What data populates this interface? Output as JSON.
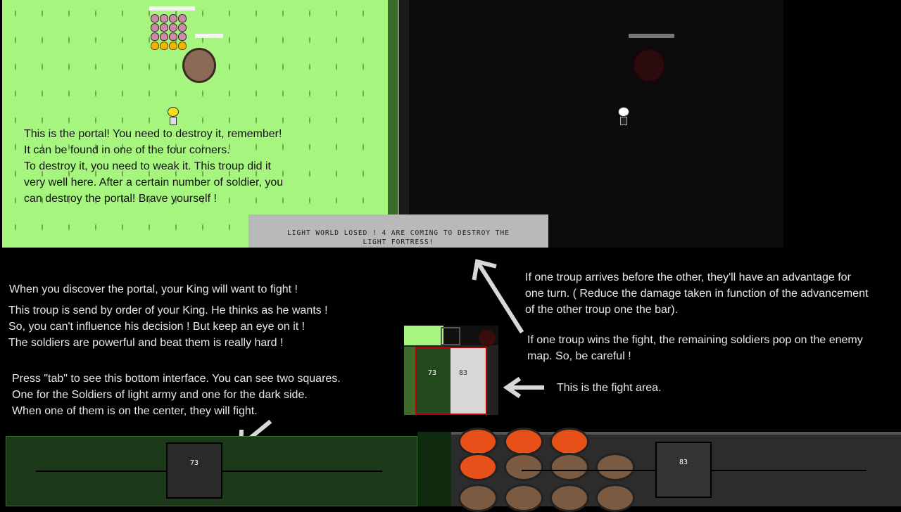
{
  "light_world": {
    "tutorial_lines": [
      "This is the portal! You need to destroy it, remember!",
      "It can be found in one of the four corners.",
      "To destroy it, you need to weak it. This troup did it",
      "very well here. After a certain number of soldier, you",
      "can destroy the portal! Brave yourself !"
    ]
  },
  "message_banner": {
    "line1": "Light world losed ! 4 are coming to destroy the",
    "line2": "light fortress!"
  },
  "notes": {
    "portal_discover": "When you discover the portal, your King will want to fight !",
    "king_order": [
      "This troup is send by order of your King. He thinks as he wants !",
      "So, you can't influence his decision ! But keep an eye on it !",
      "The soldiers are powerful and beat them is really hard !"
    ],
    "tab_help": [
      "Press \"tab\" to see this bottom interface. You can see two squares.",
      "One for the Soldiers of light army and one for the dark side.",
      "When one of them is on the center, they will fight."
    ],
    "arrival_advantage": [
      "If one troup arrives before the other, they'll have an advantage for",
      "one turn. (  Reduce the damage taken in function of the advancement",
      "of the other troup one the bar)."
    ],
    "win_fight": [
      "If one troup wins the fight, the remaining soldiers pop on the enemy",
      "map. So, be careful !"
    ],
    "fight_area": "This is the fight area."
  },
  "fight_area": {
    "light_count": "73",
    "dark_count": "83"
  },
  "bottom_interface": {
    "light_count": "73",
    "dark_count": "83"
  },
  "colors": {
    "grass": "#a6f57e",
    "dark_bg": "#0b0b0b",
    "border_red": "#b00000"
  }
}
